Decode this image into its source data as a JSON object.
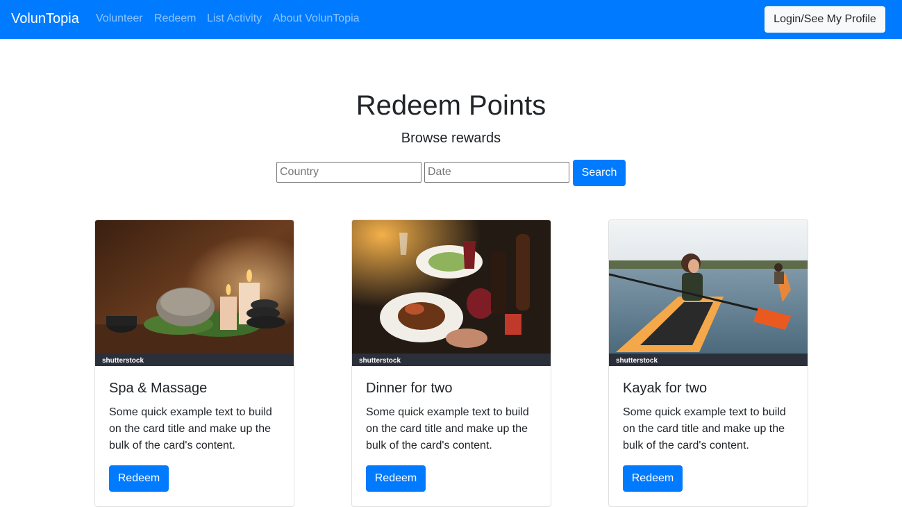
{
  "navbar": {
    "brand": "VolunTopia",
    "links": [
      "Volunteer",
      "Redeem",
      "List Activity",
      "About VolunTopia"
    ],
    "login_label": "Login/See My Profile"
  },
  "header": {
    "title": "Redeem Points",
    "subtitle": "Browse rewards"
  },
  "search": {
    "country_placeholder": "Country",
    "date_placeholder": "Date",
    "button_label": "Search"
  },
  "cards": [
    {
      "title": "Spa & Massage",
      "text": "Some quick example text to build on the card title and make up the bulk of the card's content.",
      "button_label": "Redeem",
      "watermark": "shutterstock"
    },
    {
      "title": "Dinner for two",
      "text": "Some quick example text to build on the card title and make up the bulk of the card's content.",
      "button_label": "Redeem",
      "watermark": "shutterstock"
    },
    {
      "title": "Kayak for two",
      "text": "Some quick example text to build on the card title and make up the bulk of the card's content.",
      "button_label": "Redeem",
      "watermark": "shutterstock"
    }
  ],
  "colors": {
    "primary": "#007bff",
    "navbar": "#007bff",
    "text": "#212529"
  }
}
